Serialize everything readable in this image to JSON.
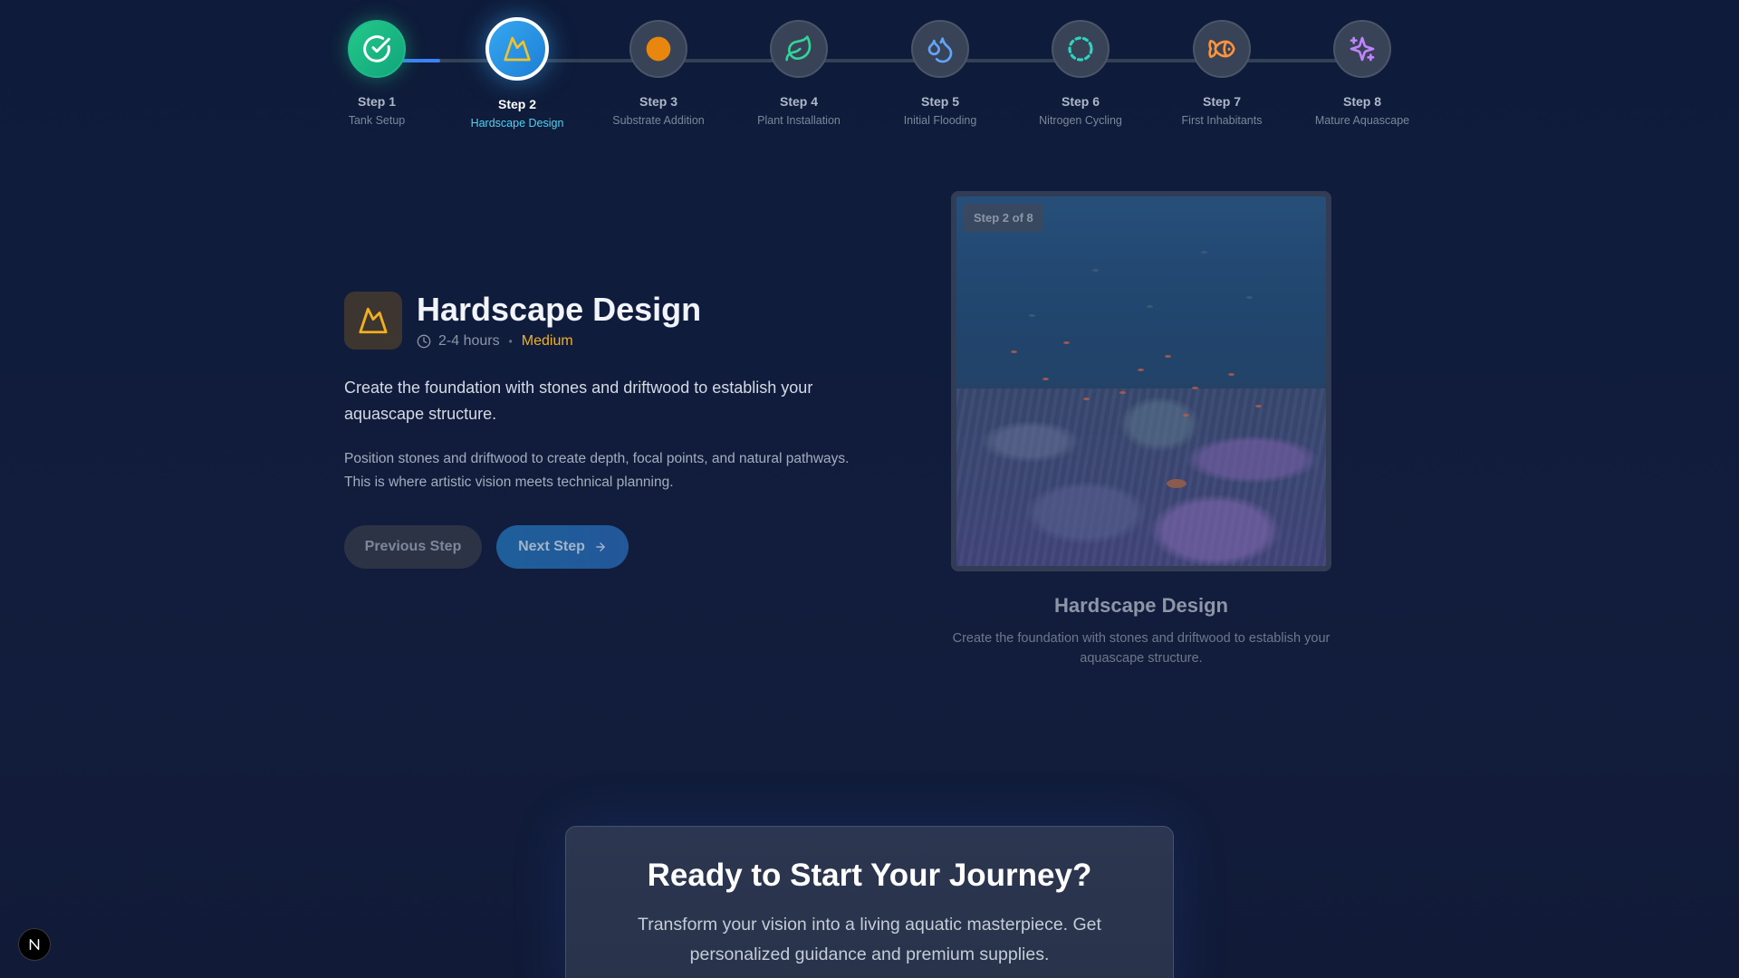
{
  "stepper": {
    "steps": [
      {
        "number": "Step 1",
        "title": "Tank Setup",
        "icon": "check-circle-icon",
        "state": "completed"
      },
      {
        "number": "Step 2",
        "title": "Hardscape Design",
        "icon": "mountain-icon",
        "state": "active"
      },
      {
        "number": "Step 3",
        "title": "Substrate Addition",
        "icon": "circle-icon",
        "state": "upcoming"
      },
      {
        "number": "Step 4",
        "title": "Plant Installation",
        "icon": "leaf-icon",
        "state": "upcoming"
      },
      {
        "number": "Step 5",
        "title": "Initial Flooding",
        "icon": "droplets-icon",
        "state": "upcoming"
      },
      {
        "number": "Step 6",
        "title": "Nitrogen Cycling",
        "icon": "dashed-circle-icon",
        "state": "upcoming"
      },
      {
        "number": "Step 7",
        "title": "First Inhabitants",
        "icon": "fish-icon",
        "state": "upcoming"
      },
      {
        "number": "Step 8",
        "title": "Mature Aquascape",
        "icon": "sparkles-icon",
        "state": "upcoming"
      }
    ]
  },
  "detail": {
    "title": "Hardscape Design",
    "duration": "2-4 hours",
    "difficulty": "Medium",
    "lead": "Create the foundation with stones and driftwood to establish your aquascape structure.",
    "body": "Position stones and driftwood to create depth, focal points, and natural pathways. This is where artistic vision meets technical planning.",
    "prev_label": "Previous Step",
    "next_label": "Next Step"
  },
  "panel": {
    "badge": "Step 2 of 8",
    "caption_title": "Hardscape Design",
    "caption_desc": "Create the foundation with stones and driftwood to establish your aquascape structure."
  },
  "cta": {
    "title": "Ready to Start Your Journey?",
    "description": "Transform your vision into a living aquatic masterpiece. Get personalized guidance and premium supplies."
  },
  "colors": {
    "background": "#0e1b3a",
    "completed": "#22c98a",
    "active": "#36a7f0",
    "active_label": "#4fd3f3",
    "difficulty": "#f2b01e",
    "progress": "#3b82f6"
  }
}
